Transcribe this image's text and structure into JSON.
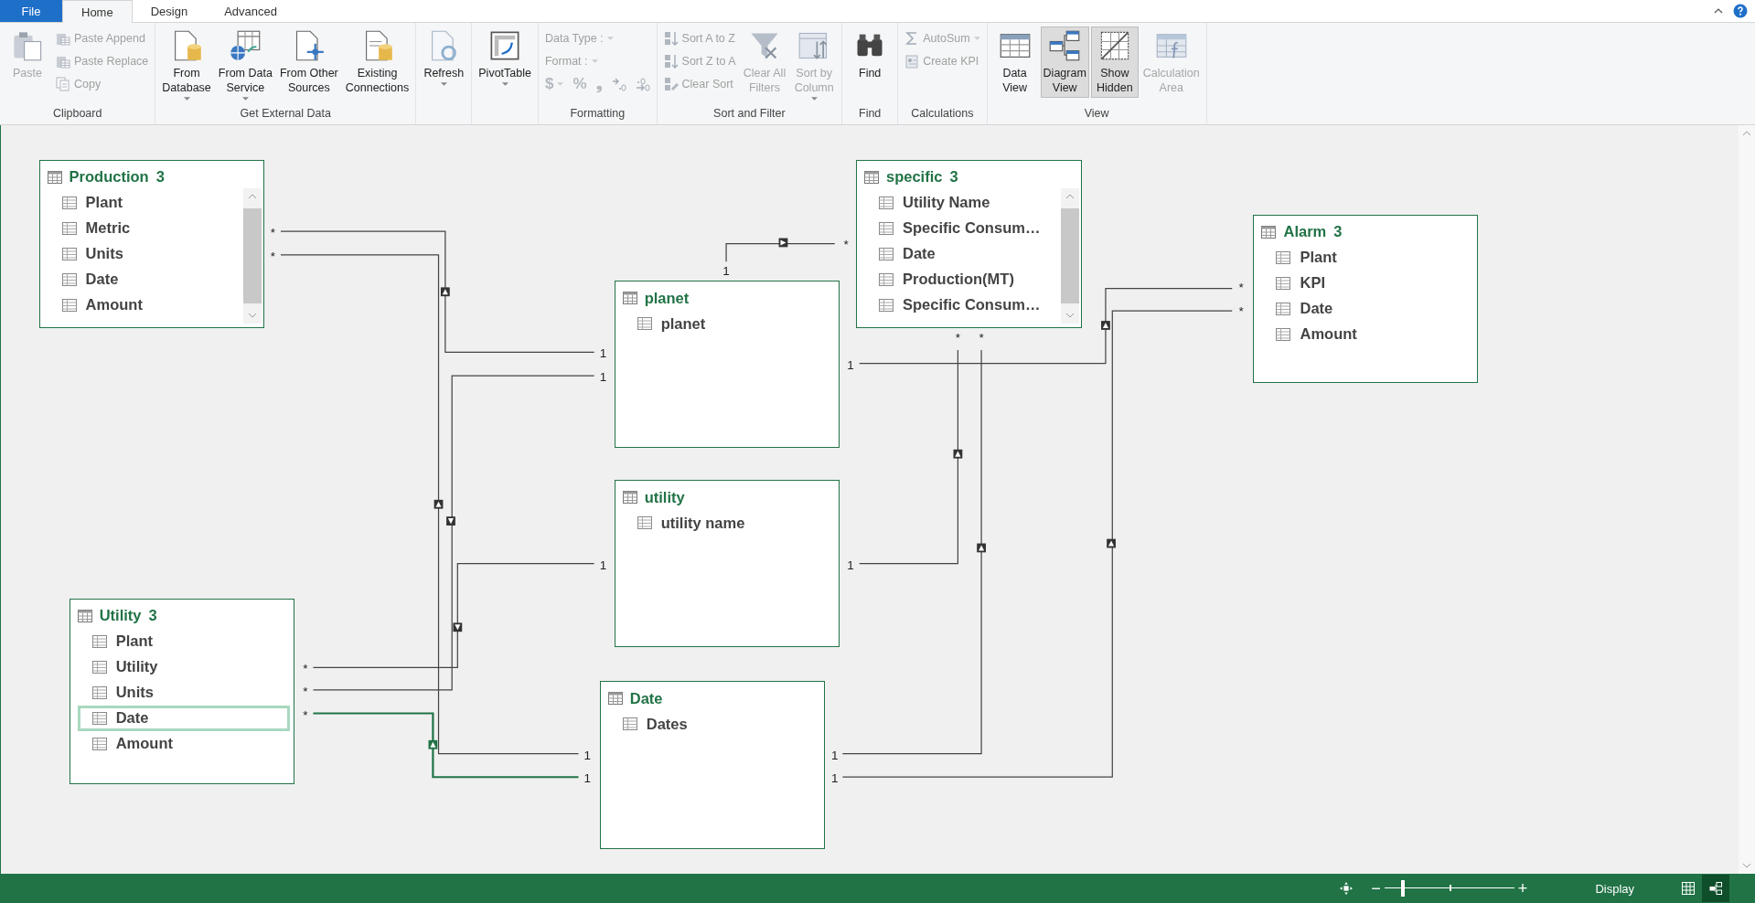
{
  "ribbon": {
    "file_tab": "File",
    "tabs": [
      {
        "label": "Home",
        "selected": true
      },
      {
        "label": "Design",
        "selected": false
      },
      {
        "label": "Advanced",
        "selected": false
      }
    ],
    "groups": [
      {
        "label": "Clipboard",
        "buttons": [
          {
            "label": "Paste",
            "kind": "large",
            "disabled": true
          },
          {
            "label": "Paste Append",
            "kind": "small",
            "disabled": true
          },
          {
            "label": "Paste Replace",
            "kind": "small",
            "disabled": true
          },
          {
            "label": "Copy",
            "kind": "small",
            "disabled": true
          }
        ]
      },
      {
        "label": "Get External Data",
        "buttons": [
          {
            "label": "From\nDatabase",
            "kind": "large",
            "disabled": false,
            "dropdown": true
          },
          {
            "label": "From Data\nService",
            "kind": "large",
            "disabled": false,
            "dropdown": true
          },
          {
            "label": "From Other\nSources",
            "kind": "large",
            "disabled": false
          },
          {
            "label": "Existing\nConnections",
            "kind": "large",
            "disabled": false
          }
        ]
      },
      {
        "buttons": [
          {
            "label": "Refresh",
            "kind": "large",
            "disabled": false,
            "dropdown": true
          }
        ]
      },
      {
        "buttons": [
          {
            "label": "PivotTable",
            "kind": "large",
            "disabled": false,
            "dropdown": true
          }
        ]
      },
      {
        "label": "Formatting",
        "buttons": [
          {
            "label": "Data Type :",
            "kind": "field",
            "disabled": true,
            "dropdown": true
          },
          {
            "label": "Format :",
            "kind": "field",
            "disabled": true,
            "dropdown": true
          },
          {
            "label": "$",
            "kind": "symbol",
            "disabled": true,
            "dropdown": true
          },
          {
            "label": "%",
            "kind": "symbol",
            "disabled": true
          },
          {
            "label": "❟",
            "kind": "symbol",
            "disabled": true
          },
          {
            "kind": "decimal",
            "disabled": true
          },
          {
            "kind": "decimal",
            "disabled": true
          }
        ]
      },
      {
        "label": "Sort and Filter",
        "buttons": [
          {
            "label": "Sort A to Z",
            "kind": "small",
            "disabled": true
          },
          {
            "label": "Sort Z to A",
            "kind": "small",
            "disabled": true
          },
          {
            "label": "Clear Sort",
            "kind": "small",
            "disabled": true
          },
          {
            "label": "Clear All\nFilters",
            "kind": "large",
            "disabled": true
          },
          {
            "label": "Sort by\nColumn",
            "kind": "large",
            "disabled": true,
            "dropdown": true
          }
        ]
      },
      {
        "label": "Find",
        "buttons": [
          {
            "label": "Find",
            "kind": "large",
            "disabled": false
          }
        ]
      },
      {
        "label": "Calculations",
        "buttons": [
          {
            "label": "AutoSum",
            "kind": "small",
            "disabled": true,
            "dropdown": true
          },
          {
            "label": "Create KPI",
            "kind": "small",
            "disabled": true
          }
        ]
      },
      {
        "label": "View",
        "buttons": [
          {
            "label": "Data\nView",
            "kind": "large",
            "disabled": false,
            "selected": false
          },
          {
            "label": "Diagram\nView",
            "kind": "large",
            "disabled": false,
            "selected": true
          },
          {
            "label": "Show\nHidden",
            "kind": "large",
            "disabled": false,
            "selected": true
          },
          {
            "label": "Calculation\nArea",
            "kind": "large",
            "disabled": true,
            "selected": false
          }
        ]
      }
    ]
  },
  "diagram": {
    "tables": [
      {
        "name": "Production",
        "count": "3",
        "columns": [
          {
            "name": "Plant",
            "selected": false
          },
          {
            "name": "Metric",
            "selected": false
          },
          {
            "name": "Units",
            "selected": false
          },
          {
            "name": "Date",
            "selected": false
          },
          {
            "name": "Amount",
            "selected": false
          }
        ]
      },
      {
        "name": "specific",
        "count": "3",
        "columns": [
          {
            "name": "Utility Name",
            "selected": false
          },
          {
            "name": "Specific Consum…",
            "selected": false
          },
          {
            "name": "Date",
            "selected": false
          },
          {
            "name": "Production(MT)",
            "selected": false
          },
          {
            "name": "Specific Consum…",
            "selected": false
          }
        ]
      },
      {
        "name": "planet",
        "columns": [
          {
            "name": "planet",
            "selected": false
          }
        ]
      },
      {
        "name": "Alarm",
        "count": "3",
        "columns": [
          {
            "name": "Plant",
            "selected": false
          },
          {
            "name": "KPI",
            "selected": false
          },
          {
            "name": "Date",
            "selected": false
          },
          {
            "name": "Amount",
            "selected": false
          }
        ]
      },
      {
        "name": "Utility",
        "count": "3",
        "columns": [
          {
            "name": "Plant",
            "selected": false
          },
          {
            "name": "Utility",
            "selected": false
          },
          {
            "name": "Units",
            "selected": false
          },
          {
            "name": "Date",
            "selected": true
          },
          {
            "name": "Amount",
            "selected": false
          }
        ]
      },
      {
        "name": "utility",
        "columns": [
          {
            "name": "utility name",
            "selected": false
          }
        ]
      },
      {
        "name": "Date",
        "columns": [
          {
            "name": "Dates",
            "selected": false
          }
        ]
      }
    ],
    "relationships": [
      {
        "selected": false
      },
      {
        "selected": false
      },
      {
        "selected": false
      },
      {
        "selected": false
      },
      {
        "selected": true
      },
      {
        "selected": false
      },
      {
        "selected": false
      },
      {
        "selected": false
      },
      {
        "selected": false
      },
      {
        "selected": false
      }
    ],
    "cardinality_labels": [
      "*",
      "*",
      "*",
      "1",
      "*",
      "*",
      "*",
      "*",
      "1",
      "1",
      "1",
      "1",
      "1",
      "*",
      "*",
      "*",
      "1",
      "1",
      "1",
      "1"
    ]
  },
  "status_bar": {
    "zoom_out": "−",
    "zoom_slider": {
      "level": 0.14
    },
    "zoom_in": "+",
    "display_label": "Display",
    "views": [
      {
        "kind": "grid",
        "selected": false
      },
      {
        "kind": "diagram",
        "selected": true
      }
    ]
  }
}
